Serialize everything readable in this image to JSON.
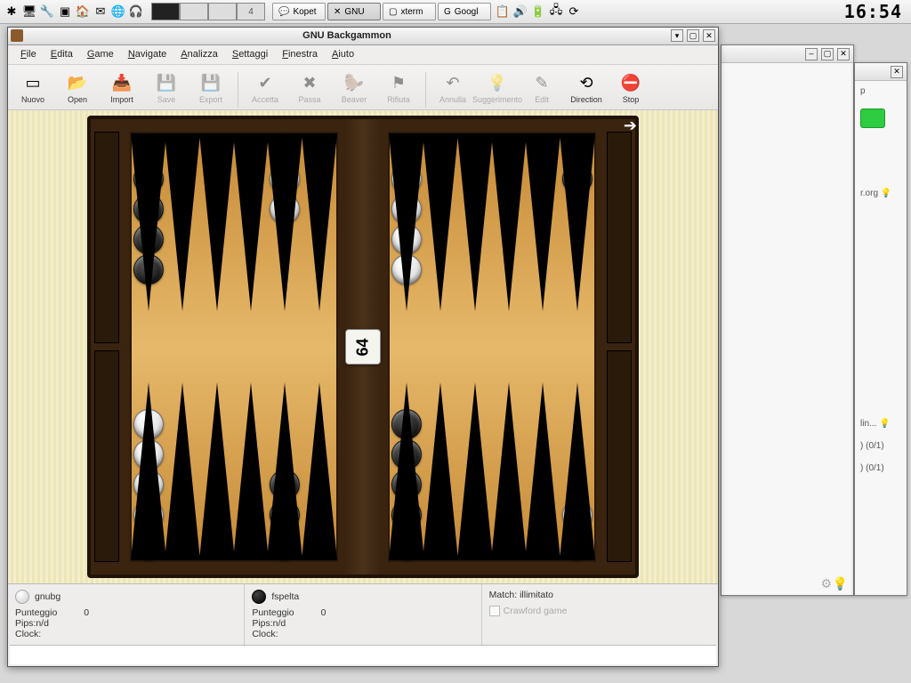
{
  "taskbar": {
    "pager": [
      "",
      "",
      "",
      "4"
    ],
    "tasks": [
      {
        "icon": "💬",
        "label": "Kopet"
      },
      {
        "icon": "✕",
        "label": "GNU",
        "active": true
      },
      {
        "icon": "▢",
        "label": "xterm"
      },
      {
        "icon": "G",
        "label": "Googl"
      }
    ],
    "clock": "16:54"
  },
  "bgwin2": {
    "lines": [
      "p",
      "r.org",
      "lin...",
      "(0/1)",
      "(0/1)"
    ]
  },
  "window": {
    "title": "GNU Backgammon",
    "menu": [
      "File",
      "Edita",
      "Game",
      "Navigate",
      "Analizza",
      "Settaggi",
      "Finestra",
      "Aiuto"
    ],
    "toolbar": [
      {
        "name": "nuovo",
        "icon": "▭",
        "label": "Nuovo",
        "enabled": true
      },
      {
        "name": "open",
        "icon": "📂",
        "label": "Open",
        "enabled": true
      },
      {
        "name": "import",
        "icon": "📥",
        "label": "Import",
        "enabled": true
      },
      {
        "name": "save",
        "icon": "💾",
        "label": "Save",
        "enabled": false
      },
      {
        "name": "export",
        "icon": "💾",
        "label": "Export",
        "enabled": false
      },
      {
        "sep": true
      },
      {
        "name": "accetta",
        "icon": "✔",
        "label": "Accetta",
        "enabled": false
      },
      {
        "name": "passa",
        "icon": "✖",
        "label": "Passa",
        "enabled": false
      },
      {
        "name": "beaver",
        "icon": "🦫",
        "label": "Beaver",
        "enabled": false
      },
      {
        "name": "rifiuta",
        "icon": "⚑",
        "label": "Rifiuta",
        "enabled": false
      },
      {
        "sep": true
      },
      {
        "name": "annulla",
        "icon": "↶",
        "label": "Annulla",
        "enabled": false
      },
      {
        "name": "suggerimento",
        "icon": "💡",
        "label": "Suggerimento",
        "enabled": false
      },
      {
        "name": "edit",
        "icon": "✎",
        "label": "Edit",
        "enabled": false
      },
      {
        "name": "direction",
        "icon": "⟲",
        "label": "Direction",
        "enabled": true
      },
      {
        "name": "stop",
        "icon": "⛔",
        "label": "Stop",
        "enabled": true
      }
    ]
  },
  "board": {
    "cube": "64",
    "points_top_left": [
      {
        "n": 5,
        "c": "b"
      },
      {
        "n": 0
      },
      {
        "n": 0
      },
      {
        "n": 0
      },
      {
        "n": 3,
        "c": "w"
      },
      {
        "n": 0
      }
    ],
    "points_top_right": [
      {
        "n": 5,
        "c": "w"
      },
      {
        "n": 0
      },
      {
        "n": 0
      },
      {
        "n": 0
      },
      {
        "n": 0
      },
      {
        "n": 2,
        "c": "b"
      }
    ],
    "points_bot_left": [
      {
        "n": 5,
        "c": "w"
      },
      {
        "n": 0
      },
      {
        "n": 0
      },
      {
        "n": 0
      },
      {
        "n": 3,
        "c": "b"
      },
      {
        "n": 0
      }
    ],
    "points_bot_right": [
      {
        "n": 5,
        "c": "b"
      },
      {
        "n": 0
      },
      {
        "n": 0
      },
      {
        "n": 0
      },
      {
        "n": 0
      },
      {
        "n": 2,
        "c": "w"
      }
    ]
  },
  "status": {
    "p1": {
      "name": "gnubg",
      "color": "w",
      "labels": {
        "score": "Punteggio",
        "pips": "Pips:n/d",
        "clock": "Clock:"
      },
      "score": "0"
    },
    "p2": {
      "name": "fspelta",
      "color": "b",
      "labels": {
        "score": "Punteggio",
        "pips": "Pips:n/d",
        "clock": "Clock:"
      },
      "score": "0"
    },
    "match_label": "Match: illimitato",
    "crawford_label": "Crawford game"
  }
}
